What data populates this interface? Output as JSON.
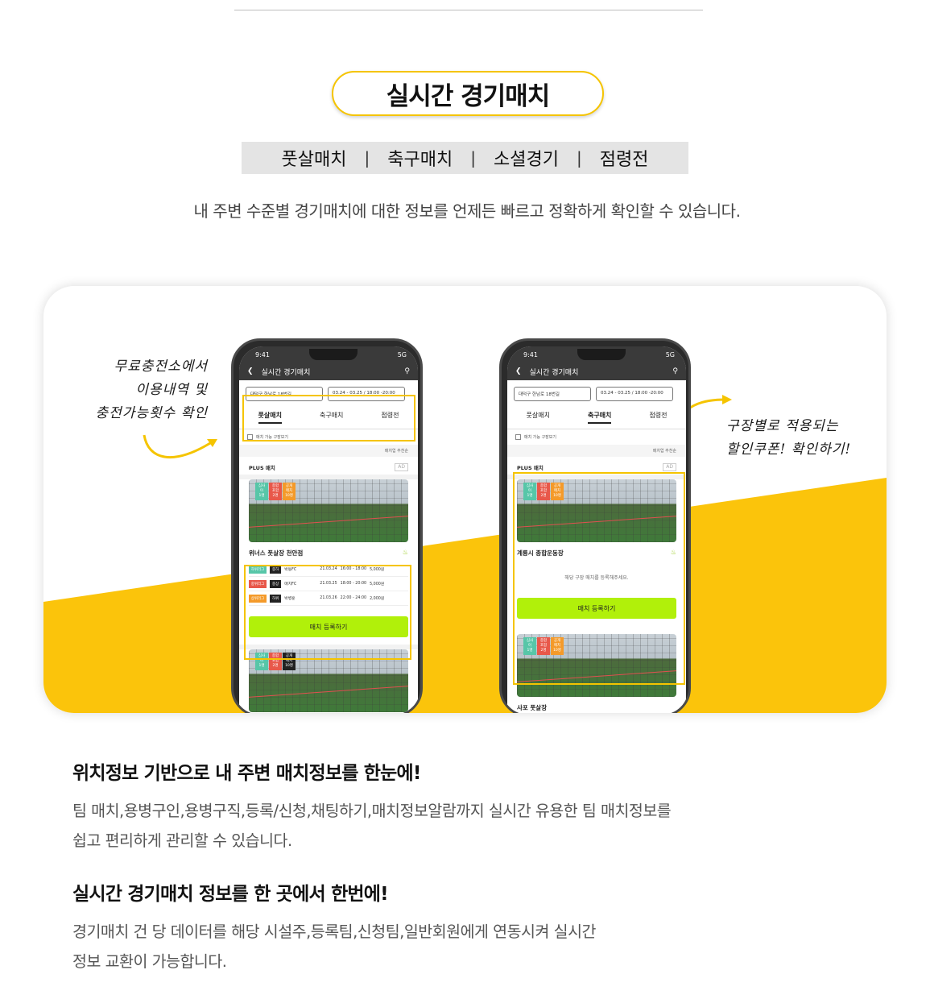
{
  "header": {
    "title": "실시간 경기매치",
    "categories": [
      "풋살매치",
      "축구매치",
      "소셜경기",
      "점령전"
    ],
    "separator": "|",
    "intro": "내 주변 수준별 경기매치에 대한 정보를 언제든 빠르고 정확하게 확인할 수 있습니다."
  },
  "notes": {
    "left": [
      "무료충전소에서",
      "이용내역 및",
      "충전가능횟수 확인"
    ],
    "right": [
      "구장별로 적용되는",
      "할인쿠폰! 확인하기!"
    ]
  },
  "phone_common": {
    "time": "9:41",
    "signal": "5G",
    "app_title": "실시간 경기매치",
    "location_filter": "대덕구 한남로 18번길",
    "date_filter": "03.24 - 03.25 / 18:00 -20:00",
    "option_label": "매치 가능 구장보기",
    "sort_label": "매치업 추천순",
    "plus_label": "PLUS 매치",
    "ad_label": "AD",
    "register_button": "매치 등록하기",
    "badges": [
      "심사이",
      "종합포함",
      "공개매치"
    ],
    "badge_values": [
      "1명",
      "2명",
      "10명"
    ]
  },
  "phone_left": {
    "tabs": [
      "풋살매치",
      "축구매치",
      "점령전"
    ],
    "active_tab": "풋살매치",
    "venue": "위너스 풋살장 천안점",
    "matches": [
      {
        "level": "하위리그",
        "level_color": "#57c6a8",
        "tag": "중하",
        "team": "박동FC",
        "date": "21.03.24",
        "time": "16:00 - 18:00",
        "fee": "5,000원"
      },
      {
        "level": "중위리그",
        "level_color": "#e8584a",
        "tag": "중상",
        "team": "매치FC",
        "date": "21.03.25",
        "time": "18:00 - 20:00",
        "fee": "5,000원"
      },
      {
        "level": "상위리그",
        "level_color": "#f49a2a",
        "tag": "하위",
        "team": "박병훈",
        "date": "21.03.26",
        "time": "22:00 - 24:00",
        "fee": "2,000원"
      }
    ]
  },
  "phone_right": {
    "tabs": [
      "풋살매치",
      "축구매치",
      "점령전"
    ],
    "active_tab": "축구매치",
    "venue": "계룡시 종합운동장",
    "empty_message": "해당 구장 매치를 등록해주세요.",
    "next_venue": "사포 풋살장"
  },
  "sections": [
    {
      "heading": "위치정보 기반으로 내 주변 매치정보를 한눈에!",
      "body": [
        "팀 매치,용병구인,용병구직,등록/신청,채팅하기,매치정보알람까지 실시간 유용한 팀 매치정보를",
        "쉽고 편리하게 관리할 수 있습니다."
      ]
    },
    {
      "heading": "실시간 경기매치 정보를 한 곳에서 한번에!",
      "body": [
        "경기매치 건 당 데이터를 해당 시설주,등록팀,신청팀,일반회원에게 연동시켜 실시간",
        "정보 교환이 가능합니다."
      ]
    }
  ],
  "colors": {
    "accent": "#f5c400",
    "cta": "#b1f00a",
    "showcase_yellow": "#fbc40b"
  }
}
